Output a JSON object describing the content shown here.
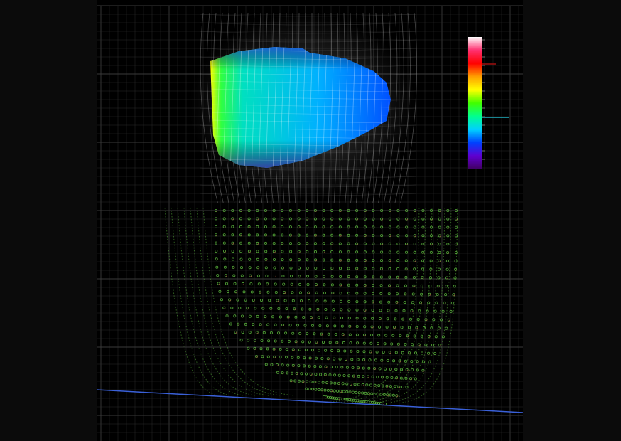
{
  "app": {
    "background": "#0b0b0b",
    "viewport_background": "#000000"
  },
  "icons": {
    "colorbar": "colorbar-icon"
  },
  "colors": {
    "grid": "#2a2a2a",
    "grid_major": "#3a3a3a",
    "ground_line": "#3a60d8",
    "mesh_point": "#5fbf3f",
    "mesh_point_inner": "#b04040",
    "wire": "#cfcfcf",
    "colorbar_marker_top": "#a01010",
    "colorbar_marker_mid": "#20b0c0"
  },
  "colorbar": {
    "stops": [
      "#ffffff",
      "#ff3070",
      "#ff0000",
      "#ffa000",
      "#ffff00",
      "#40ff00",
      "#00ff90",
      "#00d0ff",
      "#0040ff",
      "#6000d0",
      "#400060"
    ]
  }
}
